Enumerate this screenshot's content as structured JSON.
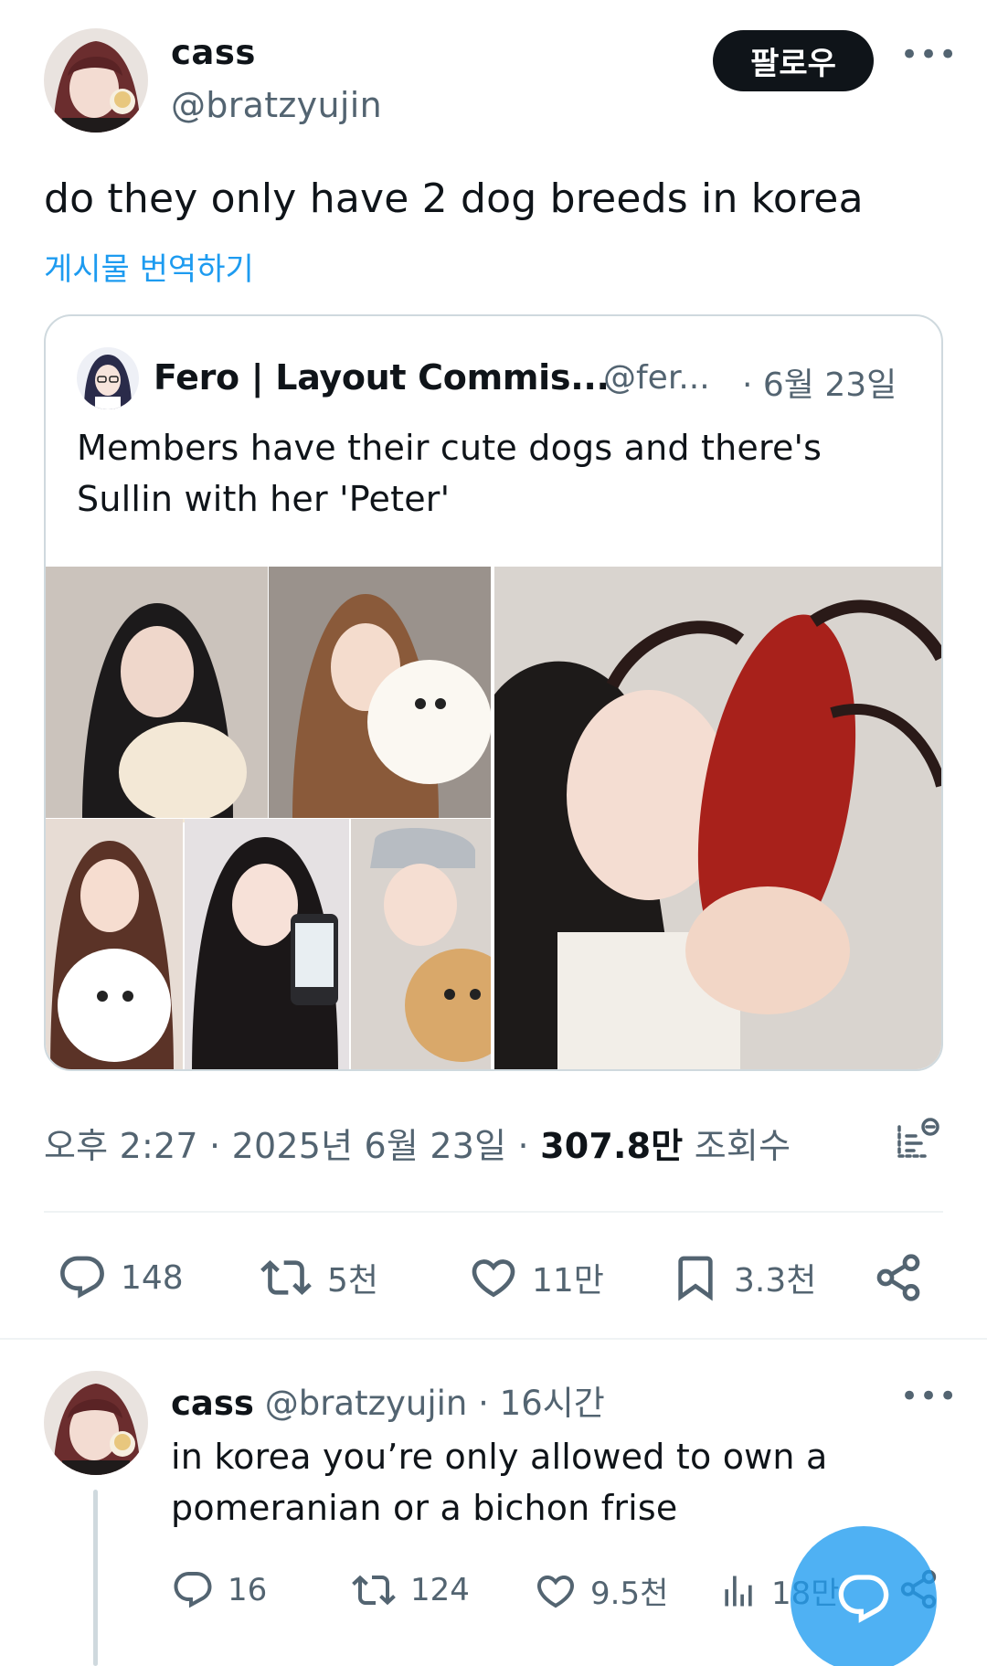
{
  "main_tweet": {
    "author_name": "cass",
    "author_handle": "@bratzyujin",
    "follow_label": "팔로우",
    "more_label": "•••",
    "text": "do they only have 2 dog breeds in korea",
    "translate_label": "게시물 번역하기",
    "meta": {
      "time": "오후 2:27",
      "date": "2025년 6월 23일",
      "views": "307.8만",
      "views_label": "조회수",
      "sep": "·"
    },
    "actions": {
      "replies": "148",
      "reposts": "5천",
      "likes": "11만",
      "bookmarks": "3.3천"
    }
  },
  "quoted_tweet": {
    "author_name": "Fero | Layout Commis...",
    "author_handle": "@fer...",
    "date": "· 6월 23일",
    "text": "Members have their cute dogs and there's Sullin with her 'Peter'"
  },
  "reply": {
    "author_name": "cass",
    "author_handle": "@bratzyujin",
    "time": "· 16시간",
    "more_label": "•••",
    "text": "in korea you’re only allowed to own a pomeranian or a bichon frise",
    "actions": {
      "replies": "16",
      "reposts": "124",
      "likes": "9.5천",
      "views": "18만"
    }
  },
  "icons": {
    "reply": "speech-bubble-icon",
    "repost": "repost-arrows-icon",
    "like": "heart-icon",
    "bookmark": "bookmark-icon",
    "share": "share-icon",
    "analytics": "analytics-icon",
    "views": "bar-chart-icon",
    "compose": "compose-reply-icon"
  },
  "colors": {
    "text_primary": "#0f1419",
    "text_secondary": "#536471",
    "accent": "#1d9bf0",
    "border": "#cfd9de",
    "follow_bg": "#0f1419"
  }
}
